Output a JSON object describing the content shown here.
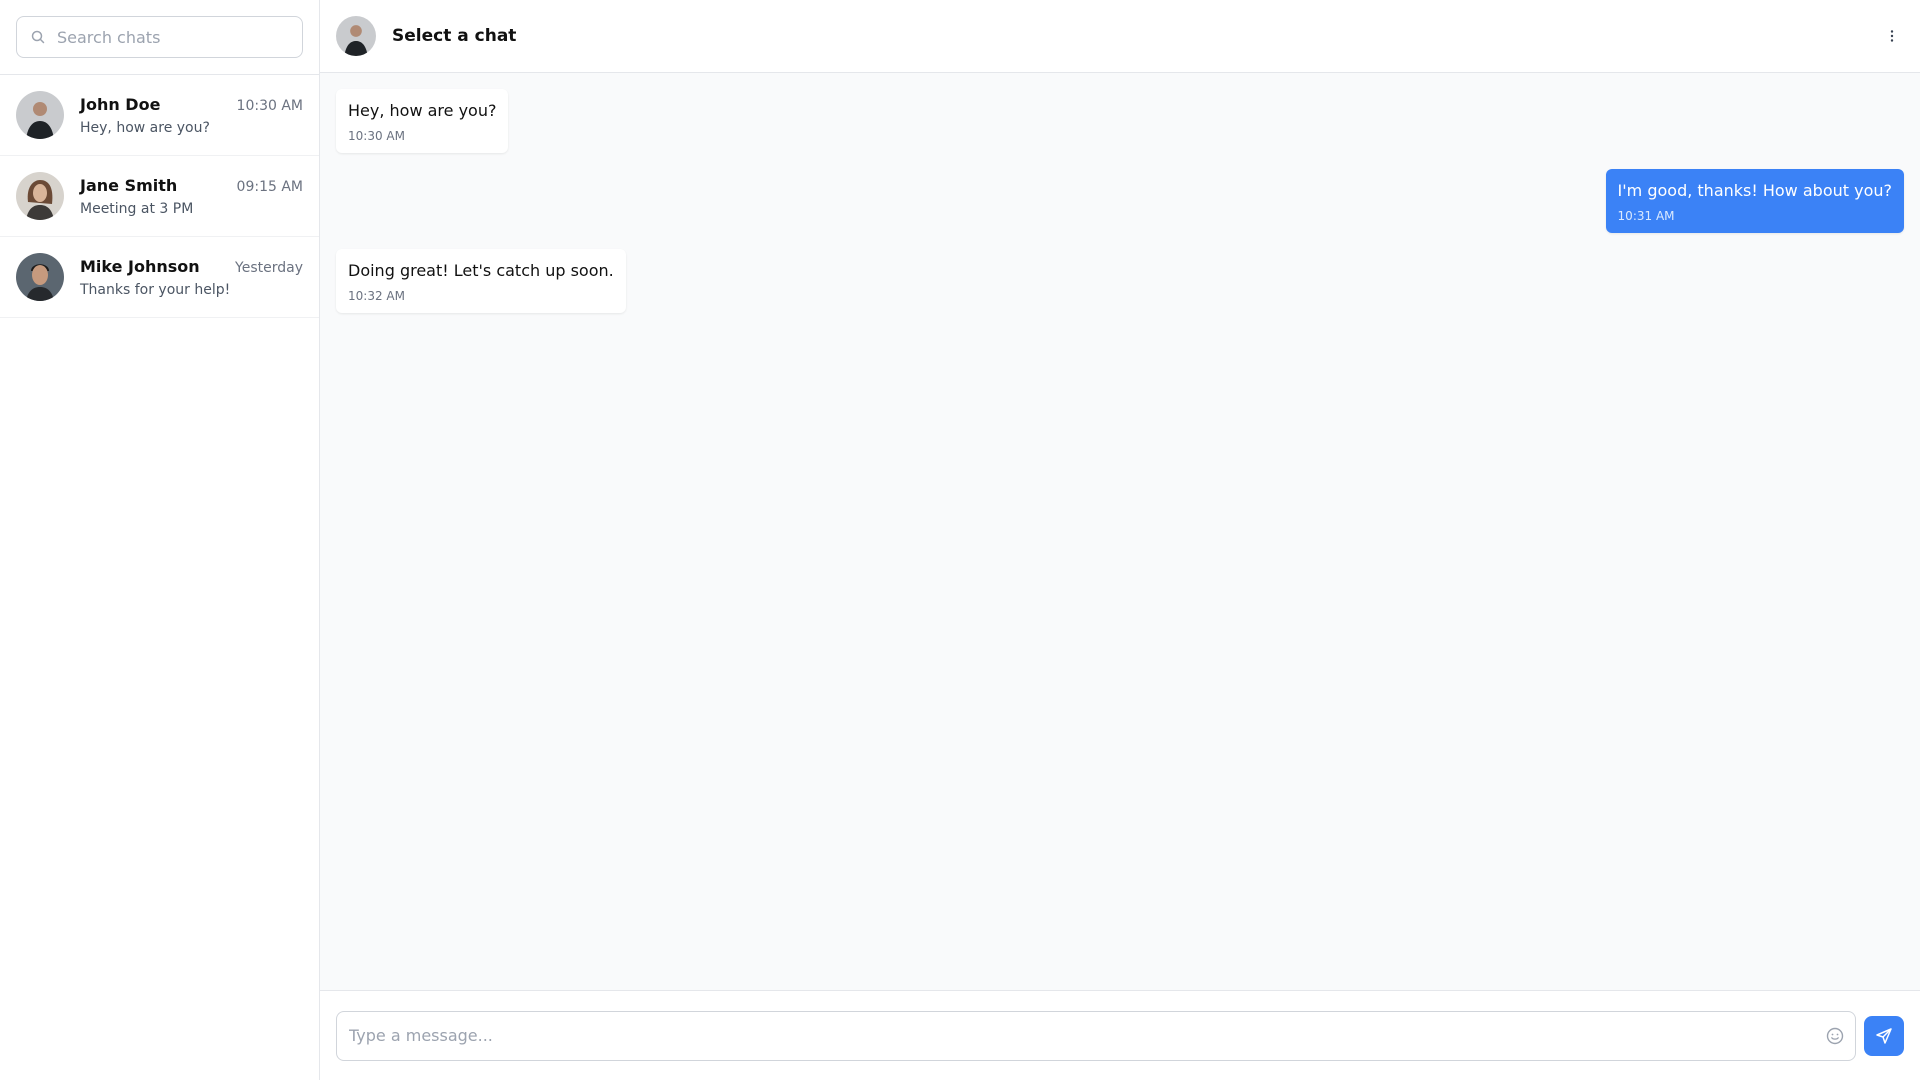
{
  "search": {
    "placeholder": "Search chats"
  },
  "chats": [
    {
      "name": "John Doe",
      "time": "10:30 AM",
      "preview": "Hey, how are you?"
    },
    {
      "name": "Jane Smith",
      "time": "09:15 AM",
      "preview": "Meeting at 3 PM"
    },
    {
      "name": "Mike Johnson",
      "time": "Yesterday",
      "preview": "Thanks for your help!"
    }
  ],
  "header": {
    "title": "Select a chat"
  },
  "messages": [
    {
      "text": "Hey, how are you?",
      "time": "10:30 AM",
      "direction": "in"
    },
    {
      "text": "I'm good, thanks! How about you?",
      "time": "10:31 AM",
      "direction": "out"
    },
    {
      "text": "Doing great! Let's catch up soon.",
      "time": "10:32 AM",
      "direction": "in"
    }
  ],
  "composer": {
    "placeholder": "Type a message..."
  },
  "colors": {
    "accent": "#3b82f6",
    "chat_background": "#f9fafb",
    "border": "#e5e7eb"
  },
  "icons": {
    "search": "search-icon",
    "menu": "more-vertical-icon",
    "emoji": "smile-icon",
    "send": "send-icon"
  }
}
